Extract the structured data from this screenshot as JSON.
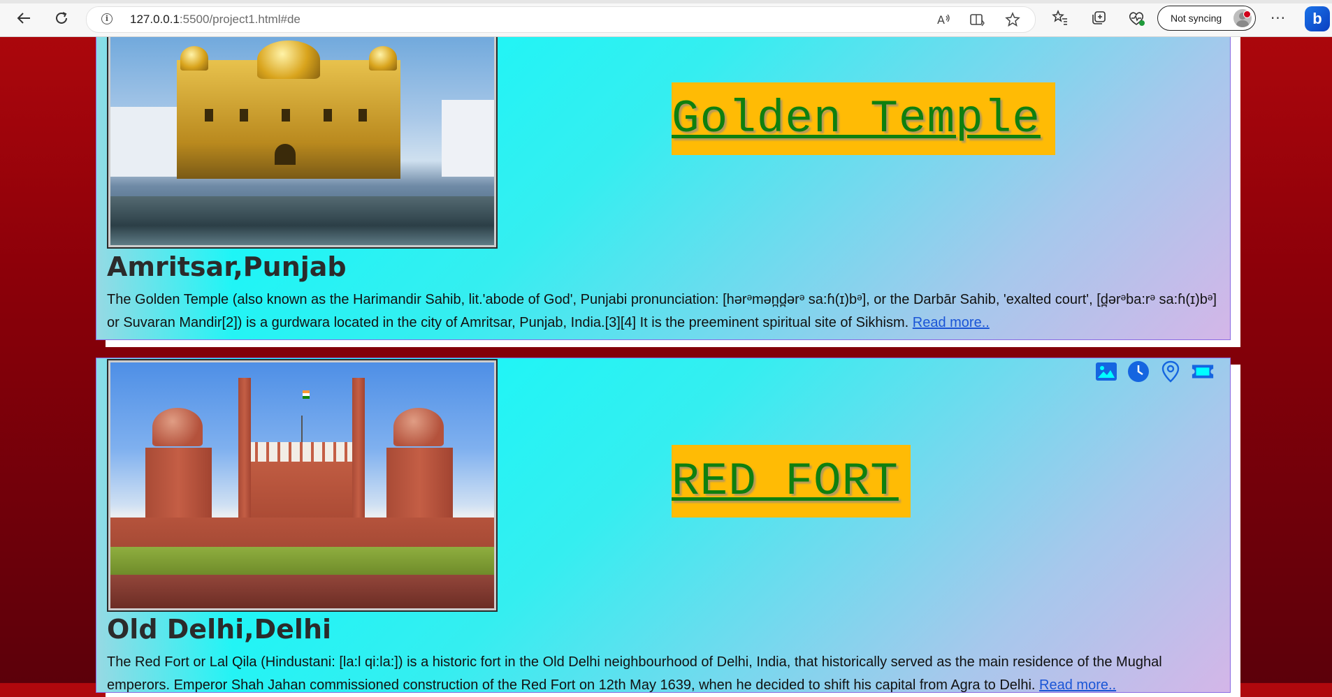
{
  "browser": {
    "url_host": "127.0.0.1",
    "url_rest": ":5500/project1.html#de",
    "sync_label": "Not syncing"
  },
  "cards": [
    {
      "title": "Golden Temple",
      "place": "Amritsar,Punjab",
      "description": "The Golden Temple (also known as the Harimandir Sahib, lit.'abode of God', Punjabi pronunciation: [hərᵊmən̪d̪ərᵊ sa:ɦ(ɪ)bᵊ], or the Darbār Sahib, 'exalted court', [d̪ərᵊba:rᵊ sa:ɦ(ɪ)bᵊ] or Suvaran Mandir[2]) is a gurdwara located in the city of Amritsar, Punjab, India.[3][4] It is the preeminent spiritual site of Sikhism.",
      "read_more": "Read more.."
    },
    {
      "title": "RED FORT",
      "place": "Old Delhi,Delhi",
      "description": "The Red Fort or Lal Qila (Hindustani: [la:l qi:la:]) is a historic fort in the Old Delhi neighbourhood of Delhi, India, that historically served as the main residence of the Mughal emperors. Emperor Shah Jahan commissioned construction of the Red Fort on 12th May 1639, when he decided to shift his capital from Agra to Delhi.",
      "read_more": "Read more..",
      "icons": [
        "image-icon",
        "clock-icon",
        "location-pin-icon",
        "ticket-icon"
      ]
    }
  ]
}
